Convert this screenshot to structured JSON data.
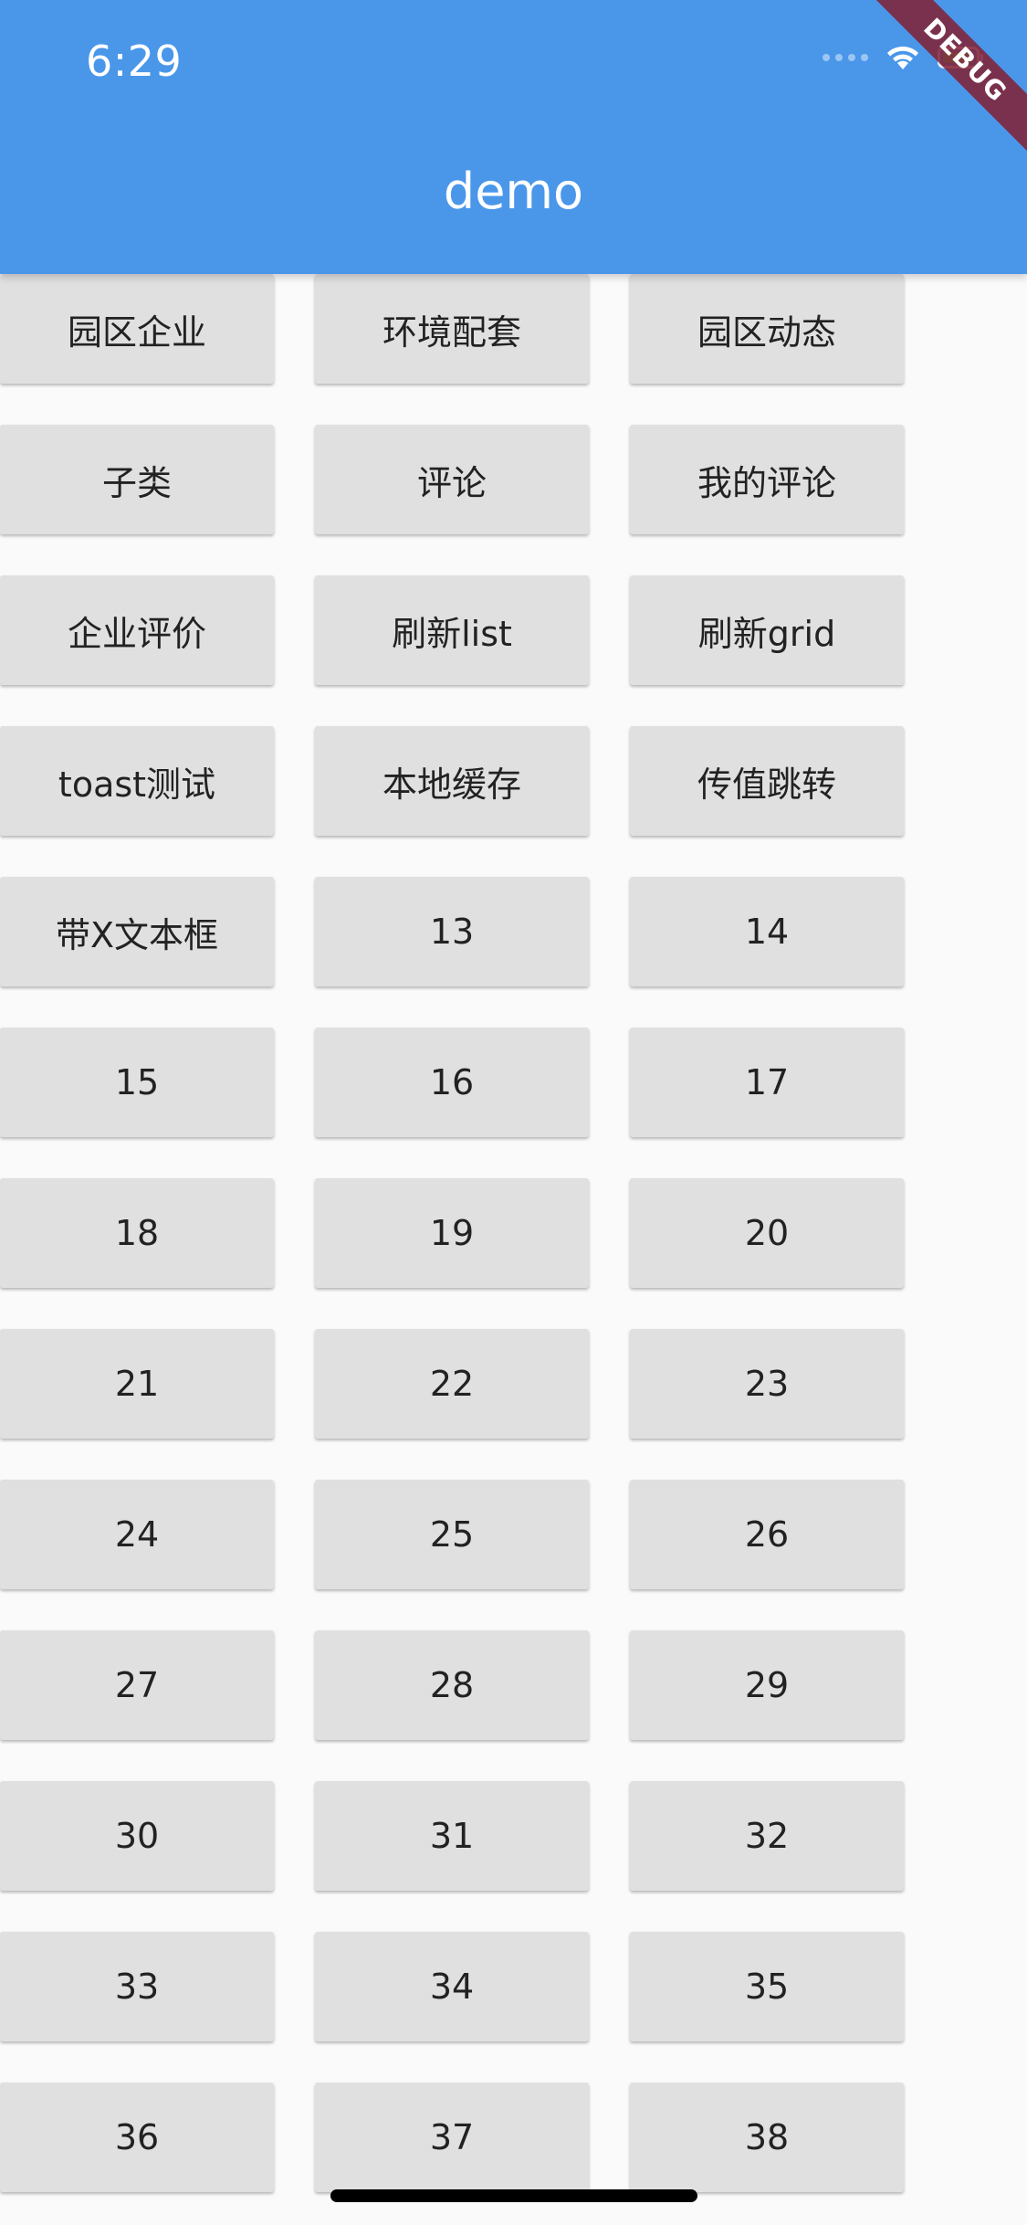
{
  "status_bar": {
    "time": "6:29",
    "icons": [
      "signal-dots-icon",
      "wifi-icon",
      "battery-icon"
    ]
  },
  "app_bar": {
    "title": "demo",
    "color": "#4a97ea"
  },
  "debug_banner": {
    "label": "DEBUG"
  },
  "buttons": [
    "园区企业",
    "环境配套",
    "园区动态",
    "子类",
    "评论",
    "我的评论",
    "企业评价",
    "刷新list",
    "刷新grid",
    "toast测试",
    "本地缓存",
    "传值跳转",
    "带X文本框",
    "13",
    "14",
    "15",
    "16",
    "17",
    "18",
    "19",
    "20",
    "21",
    "22",
    "23",
    "24",
    "25",
    "26",
    "27",
    "28",
    "29",
    "30",
    "31",
    "32",
    "33",
    "34",
    "35",
    "36",
    "37",
    "38"
  ]
}
